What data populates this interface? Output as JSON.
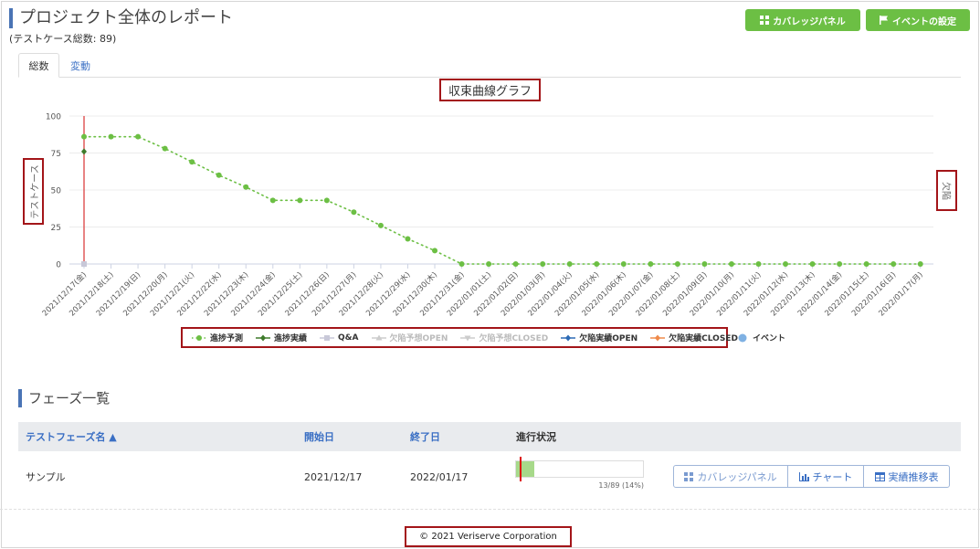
{
  "page": {
    "title": "プロジェクト全体のレポート",
    "subtitle": "(テストケース総数: 89)"
  },
  "toolbar": {
    "coverage_panel_label": "カバレッジパネル",
    "event_settings_label": "イベントの設定",
    "accent_color": "#6cbf44"
  },
  "tabs": [
    {
      "label": "総数",
      "active": true
    },
    {
      "label": "変動",
      "active": false
    }
  ],
  "chart_data": {
    "type": "line",
    "title": "収束曲線グラフ",
    "ylabel": "テストケース",
    "y2label": "欠陥",
    "ylim": [
      0,
      100
    ],
    "y_ticks": [
      0,
      25,
      50,
      75,
      100
    ],
    "grid": true,
    "legend_position": "bottom",
    "categories": [
      "2021/12/17(金)",
      "2021/12/18(土)",
      "2021/12/19(日)",
      "2021/12/20(月)",
      "2021/12/21(火)",
      "2021/12/22(水)",
      "2021/12/23(木)",
      "2021/12/24(金)",
      "2021/12/25(土)",
      "2021/12/26(日)",
      "2021/12/27(月)",
      "2021/12/28(火)",
      "2021/12/29(水)",
      "2021/12/30(木)",
      "2021/12/31(金)",
      "2022/01/01(土)",
      "2022/01/02(日)",
      "2022/01/03(月)",
      "2022/01/04(火)",
      "2022/01/05(水)",
      "2022/01/06(木)",
      "2022/01/07(金)",
      "2022/01/08(土)",
      "2022/01/09(日)",
      "2022/01/10(月)",
      "2022/01/11(火)",
      "2022/01/12(水)",
      "2022/01/13(木)",
      "2022/01/14(金)",
      "2022/01/15(土)",
      "2022/01/16(日)",
      "2022/01/17(月)"
    ],
    "series": [
      {
        "name": "進捗予測",
        "color": "#6cbf44",
        "style": "dotted",
        "values": [
          86,
          86,
          86,
          78,
          69,
          60,
          52,
          43,
          43,
          43,
          35,
          26,
          17,
          9,
          0,
          0,
          0,
          0,
          0,
          0,
          0,
          0,
          0,
          0,
          0,
          0,
          0,
          0,
          0,
          0,
          0,
          0
        ]
      },
      {
        "name": "進捗実績",
        "color": "#3d7a2a",
        "style": "solid",
        "values": [
          76
        ]
      },
      {
        "name": "Q&A",
        "color": "#c8c8d8",
        "style": "solid",
        "values": [
          0
        ]
      }
    ],
    "event_line": {
      "category": "2021/12/17(金)",
      "color": "#e05a5a"
    }
  },
  "legend": [
    {
      "label": "進捗予測",
      "color": "#6cbf44",
      "marker": "dot-dotted",
      "muted": false
    },
    {
      "label": "進捗実績",
      "color": "#3d7a2a",
      "marker": "diamond-line",
      "muted": false
    },
    {
      "label": "Q&A",
      "color": "#c8c8d8",
      "marker": "square-line",
      "muted": false
    },
    {
      "label": "欠陥予想OPEN",
      "color": "#cccccc",
      "marker": "triangle-up",
      "muted": true
    },
    {
      "label": "欠陥予想CLOSED",
      "color": "#cccccc",
      "marker": "triangle-down",
      "muted": true
    },
    {
      "label": "欠陥実績OPEN",
      "color": "#2d6bb5",
      "marker": "diamond-line",
      "muted": false
    },
    {
      "label": "欠陥実績CLOSED",
      "color": "#ef8a4a",
      "marker": "diamond-line",
      "muted": false
    }
  ],
  "legend_event": {
    "label": "イベント",
    "color": "#7fb1e3"
  },
  "phases": {
    "title": "フェーズ一覧",
    "columns": {
      "name": "テストフェーズ名 ▲",
      "start": "開始日",
      "end": "終了日",
      "status": "進行状況"
    },
    "rows": [
      {
        "name": "サンプル",
        "start": "2021/12/17",
        "end": "2022/01/17",
        "progress_text": "13/89 (14%)",
        "progress_fraction": 0.146,
        "actions": {
          "coverage": "カバレッジパネル",
          "chart": "チャート",
          "trend": "実績推移表"
        }
      }
    ]
  },
  "footer": {
    "copyright": "© 2021 Veriserve Corporation"
  }
}
